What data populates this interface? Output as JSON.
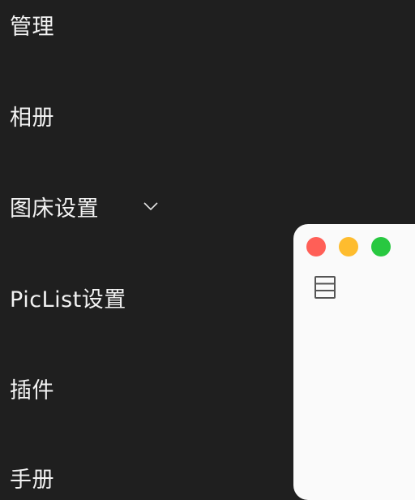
{
  "sidebar": {
    "items": [
      {
        "label": "管理"
      },
      {
        "label": "相册"
      },
      {
        "label": "图床设置",
        "icon": "chevron-down-icon"
      },
      {
        "label": "PicList设置"
      },
      {
        "label": "插件"
      },
      {
        "label": "手册"
      }
    ]
  },
  "mini_window": {
    "traffic_lights": [
      "close-icon",
      "minimize-icon",
      "maximize-icon"
    ],
    "toolbar_icon": "list-icon",
    "colors": {
      "close": "#ff5f57",
      "minimize": "#febc2e",
      "maximize": "#28c840",
      "background": "#fafafa"
    }
  },
  "colors": {
    "sidebar_background": "#1f1f1f",
    "text": "#f2f2f2"
  }
}
